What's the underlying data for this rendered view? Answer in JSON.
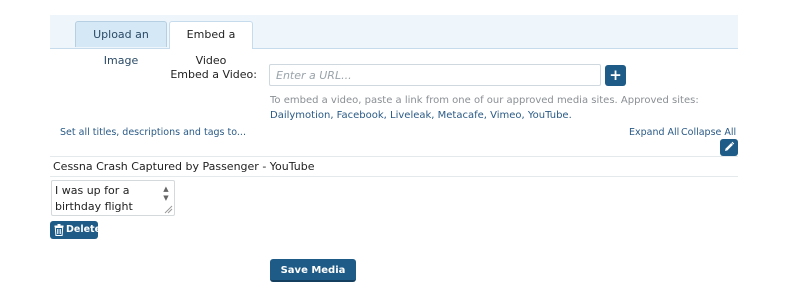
{
  "tabs": [
    {
      "label": "Upload an Image",
      "active": false
    },
    {
      "label": "Embed a Video",
      "active": true
    }
  ],
  "embed": {
    "label": "Embed a Video:",
    "url_value": "",
    "url_placeholder": "Enter a URL...",
    "add_icon": "plus-icon",
    "help_text": "To embed a video, paste a link from one of our approved media sites. Approved sites:",
    "approved_sites": "Dailymotion, Facebook, Liveleak, Metacafe, Vimeo, YouTube."
  },
  "controls": {
    "set_all": "Set all titles, descriptions and tags to...",
    "expand_all": "Expand All",
    "collapse_all": "Collapse All",
    "edit_icon": "pencil-icon"
  },
  "media_item": {
    "title": "Cessna Crash Captured by Passenger - YouTube",
    "description": "I was up for a birthday flight with",
    "delete_label": "Delete",
    "delete_icon": "trash-icon"
  },
  "save_label": "Save Media",
  "colors": {
    "accent": "#1e5b87",
    "link": "#2a5a86",
    "tab_bg": "#eef5fb"
  }
}
